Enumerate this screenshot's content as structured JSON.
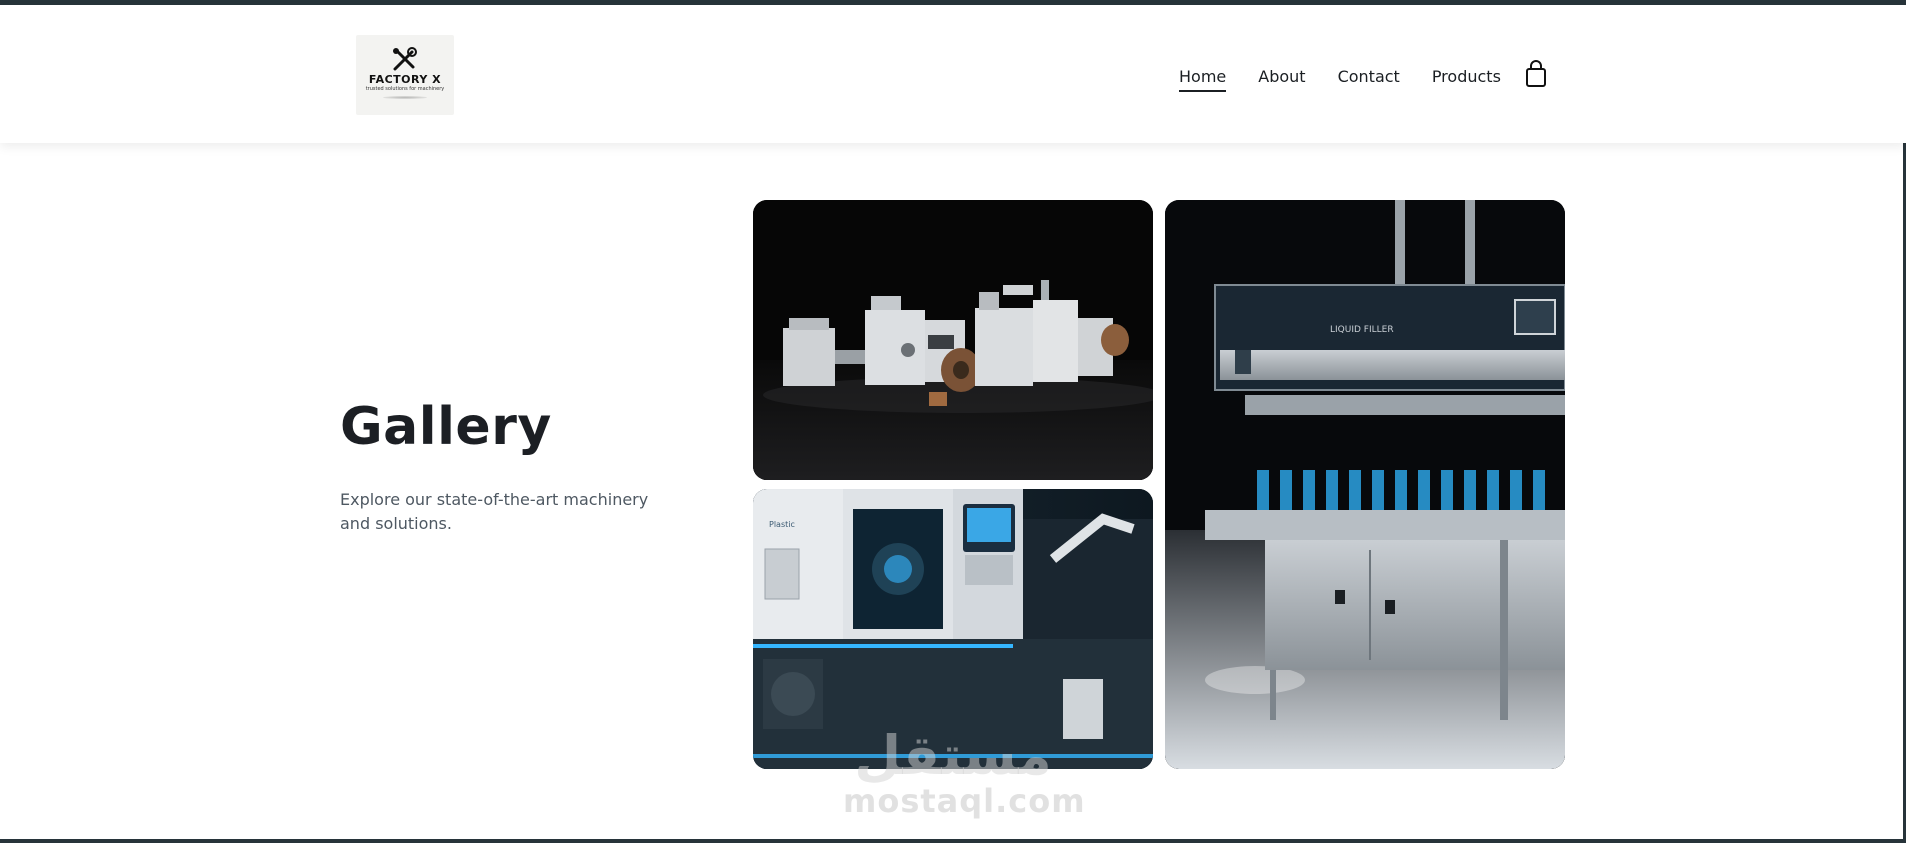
{
  "header": {
    "logo": {
      "name": "FACTORY X",
      "tagline": "trusted solutions for machinery",
      "icon": "wrench-gear-icon"
    },
    "nav": [
      {
        "label": "Home",
        "active": true
      },
      {
        "label": "About",
        "active": false
      },
      {
        "label": "Contact",
        "active": false
      },
      {
        "label": "Products",
        "active": false
      }
    ],
    "cart_icon": "shopping-bag-icon"
  },
  "hero": {
    "title": "Gallery",
    "subtitle": "Explore our state-of-the-art machinery and solutions."
  },
  "gallery": {
    "images": [
      {
        "subject": "paper-bag-making-machine"
      },
      {
        "subject": "plastic-injection-molding-machine",
        "panel_text": "Plastic"
      },
      {
        "subject": "bottle-filling-machine",
        "panel_text": "LIQUID FILLER"
      }
    ]
  },
  "watermark": {
    "arabic": "مستقل",
    "latin": "mostaql.com"
  },
  "colors": {
    "frame": "#27343a",
    "text": "#1c1f24",
    "muted": "#4e5862",
    "accent_glow": "#35b6ff"
  }
}
